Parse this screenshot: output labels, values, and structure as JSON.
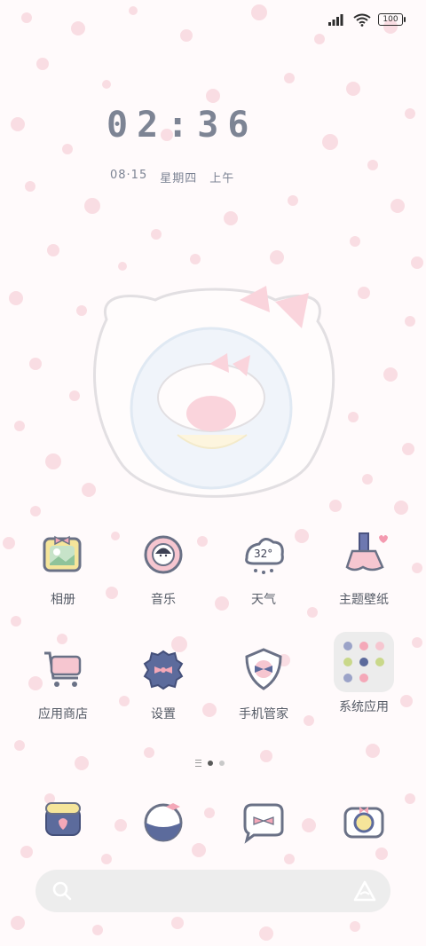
{
  "status_bar": {
    "battery": "100",
    "signal_icon": "signal-icon",
    "wifi_icon": "wifi-icon"
  },
  "clock": {
    "time": "02:36"
  },
  "date": {
    "day": "08·15",
    "weekday": "星期四",
    "period": "上午"
  },
  "apps": [
    {
      "label": "相册",
      "icon": "photo-album-icon"
    },
    {
      "label": "音乐",
      "icon": "music-icon"
    },
    {
      "label": "天气",
      "icon": "weather-icon",
      "temperature": "32°"
    },
    {
      "label": "主题壁纸",
      "icon": "theme-wallpaper-icon"
    },
    {
      "label": "应用商店",
      "icon": "app-store-icon"
    },
    {
      "label": "设置",
      "icon": "settings-icon"
    },
    {
      "label": "手机管家",
      "icon": "phone-manager-icon"
    },
    {
      "label": "系统应用",
      "icon": "system-apps-folder-icon"
    }
  ],
  "page_indicator": {
    "pages": 2,
    "active": 1
  },
  "dock": [
    "phone-icon",
    "browser-icon",
    "messages-icon",
    "camera-icon"
  ],
  "colors": {
    "accent_pink": "#f4a8b8",
    "navy": "#5c6b9c",
    "text": "#555b66"
  }
}
